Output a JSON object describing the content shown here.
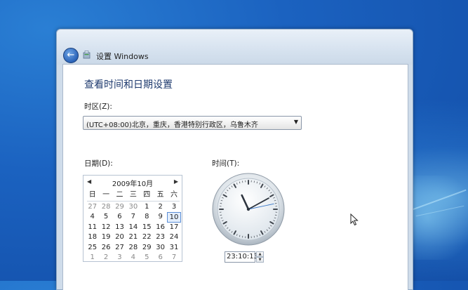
{
  "window": {
    "title": "设置 Windows",
    "back_icon": "back-arrow-icon",
    "setup_icon": "setup-icon"
  },
  "page": {
    "heading": "查看时间和日期设置",
    "timezone_label": "时区(Z):",
    "timezone_value": "(UTC+08:00)北京，重庆，香港特别行政区，乌鲁木齐",
    "date_label": "日期(D):",
    "time_label": "时间(T):",
    "time_value": "23:10:13"
  },
  "calendar": {
    "month_title": "2009年10月",
    "weekdays": [
      "日",
      "一",
      "二",
      "三",
      "四",
      "五",
      "六"
    ],
    "weeks": [
      [
        {
          "d": "27",
          "other": true
        },
        {
          "d": "28",
          "other": true
        },
        {
          "d": "29",
          "other": true
        },
        {
          "d": "30",
          "other": true
        },
        {
          "d": "1"
        },
        {
          "d": "2"
        },
        {
          "d": "3"
        }
      ],
      [
        {
          "d": "4"
        },
        {
          "d": "5"
        },
        {
          "d": "6"
        },
        {
          "d": "7"
        },
        {
          "d": "8"
        },
        {
          "d": "9"
        },
        {
          "d": "10",
          "selected": true
        }
      ],
      [
        {
          "d": "11"
        },
        {
          "d": "12"
        },
        {
          "d": "13"
        },
        {
          "d": "14"
        },
        {
          "d": "15"
        },
        {
          "d": "16"
        },
        {
          "d": "17"
        }
      ],
      [
        {
          "d": "18"
        },
        {
          "d": "19"
        },
        {
          "d": "20"
        },
        {
          "d": "21"
        },
        {
          "d": "22"
        },
        {
          "d": "23"
        },
        {
          "d": "24"
        }
      ],
      [
        {
          "d": "25"
        },
        {
          "d": "26"
        },
        {
          "d": "27"
        },
        {
          "d": "28"
        },
        {
          "d": "29"
        },
        {
          "d": "30"
        },
        {
          "d": "31"
        }
      ],
      [
        {
          "d": "1",
          "other": true
        },
        {
          "d": "2",
          "other": true
        },
        {
          "d": "3",
          "other": true
        },
        {
          "d": "4",
          "other": true
        },
        {
          "d": "5",
          "other": true
        },
        {
          "d": "6",
          "other": true
        },
        {
          "d": "7",
          "other": true
        }
      ]
    ]
  },
  "colors": {
    "heading": "#1e3a6e",
    "desktop": "#1b62c0",
    "selection": "#5b8ed6"
  }
}
